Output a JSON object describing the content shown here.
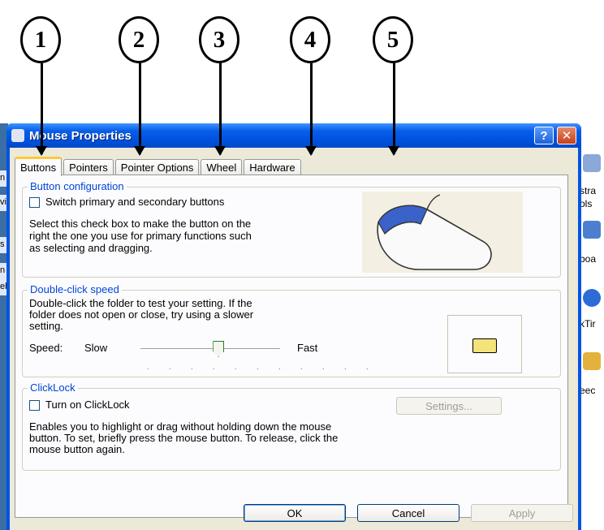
{
  "callouts": [
    "1",
    "2",
    "3",
    "4",
    "5"
  ],
  "window": {
    "title": "Mouse Properties",
    "help": "?",
    "close": "✕"
  },
  "tabs": [
    {
      "label": "Buttons",
      "active": true
    },
    {
      "label": "Pointers",
      "active": false
    },
    {
      "label": "Pointer Options",
      "active": false
    },
    {
      "label": "Wheel",
      "active": false
    },
    {
      "label": "Hardware",
      "active": false
    }
  ],
  "button_config": {
    "heading": "Button configuration",
    "checkbox_label": "Switch primary and secondary buttons",
    "checked": false,
    "desc1": "Select this check box to make the button on the",
    "desc2": "right the one you use for primary functions such",
    "desc3": "as selecting and dragging."
  },
  "double_click": {
    "heading": "Double-click speed",
    "desc1": "Double-click the folder to test your setting. If the",
    "desc2": "folder does not open or close, try using a slower",
    "desc3": "setting.",
    "speed_label": "Speed:",
    "slow_label": "Slow",
    "fast_label": "Fast",
    "slider_fraction": 0.56,
    "tick_count": 11
  },
  "clicklock": {
    "heading": "ClickLock",
    "checkbox_label": "Turn on ClickLock",
    "checked": false,
    "settings_label": "Settings...",
    "desc1": "Enables you to highlight or drag without holding down the mouse",
    "desc2": "button. To set, briefly press the mouse button. To release, click the",
    "desc3": "mouse button again."
  },
  "buttons": {
    "ok": "OK",
    "cancel": "Cancel",
    "apply": "Apply"
  },
  "left_fragments": [
    "n",
    "vit",
    "s",
    "n",
    "elp"
  ],
  "desktop_fragments": [
    "stra",
    "ols",
    "boa",
    "kTir",
    "eec"
  ],
  "colors": {
    "titlebar": "#0054e3",
    "group_heading": "#0046d5",
    "dialog_bg": "#ece9d8",
    "tab_accent": "#ffc83c"
  }
}
